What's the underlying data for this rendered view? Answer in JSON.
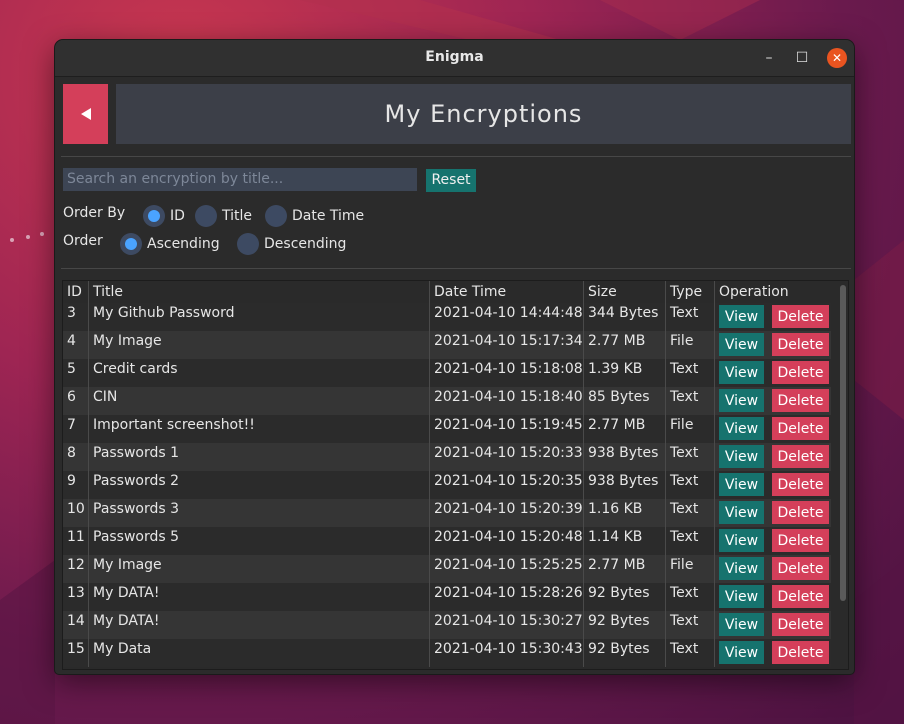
{
  "window": {
    "title": "Enigma"
  },
  "window_controls": {
    "minimize": "–",
    "maximize": "☐",
    "close": "✕"
  },
  "header": {
    "title": "My Encryptions"
  },
  "search": {
    "placeholder": "Search an encryption by title...",
    "value": "",
    "reset_label": "Reset"
  },
  "order_by": {
    "label": "Order By",
    "options": [
      {
        "label": "ID",
        "selected": true
      },
      {
        "label": "Title",
        "selected": false
      },
      {
        "label": "Date Time",
        "selected": false
      }
    ]
  },
  "order": {
    "label": "Order",
    "options": [
      {
        "label": "Ascending",
        "selected": true
      },
      {
        "label": "Descending",
        "selected": false
      }
    ]
  },
  "table": {
    "columns": [
      "ID",
      "Title",
      "Date Time",
      "Size",
      "Type",
      "Operation"
    ],
    "view_label": "View",
    "delete_label": "Delete",
    "rows": [
      [
        "3",
        "My Github Password",
        "2021-04-10 14:44:48",
        "344 Bytes",
        "Text"
      ],
      [
        "4",
        "My Image",
        "2021-04-10 15:17:34",
        "2.77 MB",
        "File"
      ],
      [
        "5",
        "Credit cards",
        "2021-04-10 15:18:08",
        "1.39 KB",
        "Text"
      ],
      [
        "6",
        "CIN",
        "2021-04-10 15:18:40",
        "85 Bytes",
        "Text"
      ],
      [
        "7",
        "Important screenshot!!",
        "2021-04-10 15:19:45",
        "2.77 MB",
        "File"
      ],
      [
        "8",
        "Passwords 1",
        "2021-04-10 15:20:33",
        "938 Bytes",
        "Text"
      ],
      [
        "9",
        "Passwords 2",
        "2021-04-10 15:20:35",
        "938 Bytes",
        "Text"
      ],
      [
        "10",
        "Passwords 3",
        "2021-04-10 15:20:39",
        "1.16 KB",
        "Text"
      ],
      [
        "11",
        "Passwords 5",
        "2021-04-10 15:20:48",
        "1.14 KB",
        "Text"
      ],
      [
        "12",
        "My Image",
        "2021-04-10 15:25:25",
        "2.77 MB",
        "File"
      ],
      [
        "13",
        "My DATA!",
        "2021-04-10 15:28:26",
        "92 Bytes",
        "Text"
      ],
      [
        "14",
        "My DATA!",
        "2021-04-10 15:30:27",
        "92 Bytes",
        "Text"
      ],
      [
        "15",
        "My Data",
        "2021-04-10 15:30:43",
        "92 Bytes",
        "Text"
      ]
    ]
  },
  "colors": {
    "accent": "#16736e",
    "danger": "#d43f5a",
    "radio_selected": "#4aa3ff"
  },
  "icons": {
    "back": "back-arrow-icon"
  }
}
